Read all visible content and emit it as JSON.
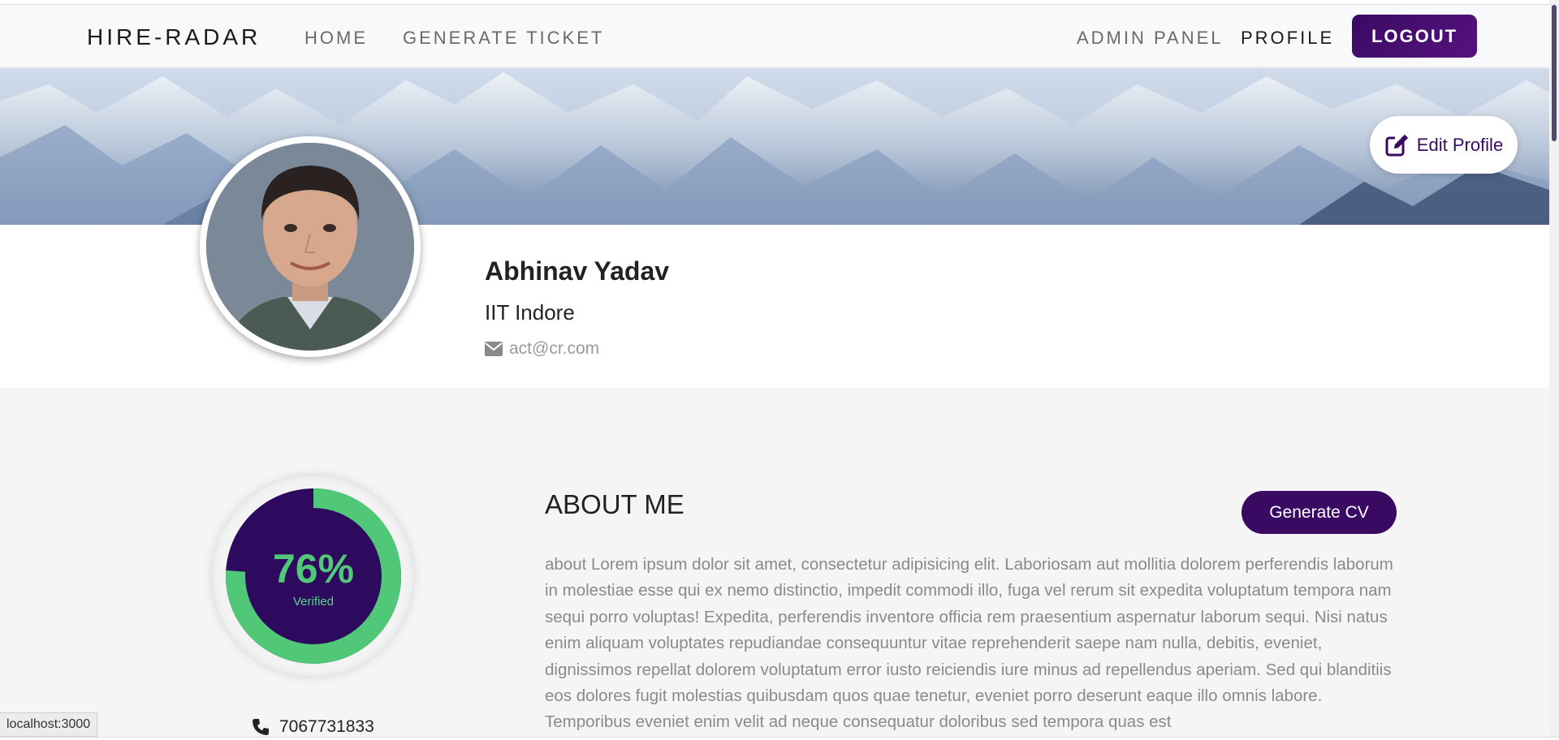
{
  "navbar": {
    "brand": "HIRE-RADAR",
    "links": [
      "HOME",
      "GENERATE TICKET"
    ],
    "admin_label": "ADMIN PANEL",
    "profile_label": "PROFILE",
    "logout_label": "LOGOUT"
  },
  "banner": {
    "edit_profile_label": "Edit Profile"
  },
  "profile": {
    "name": "Abhinav Yadav",
    "institute": "IIT Indore",
    "email": "act@cr.com",
    "phone": "7067731833"
  },
  "verification": {
    "percent_text": "76%",
    "percent_value": 76,
    "label": "Verified"
  },
  "about": {
    "title": "ABOUT ME",
    "generate_cv_label": "Generate CV",
    "body": "about Lorem ipsum dolor sit amet, consectetur adipisicing elit. Laboriosam aut mollitia dolorem perferendis laborum in molestiae esse qui ex nemo distinctio, impedit commodi illo, fuga vel rerum sit expedita voluptatum tempora nam sequi porro voluptas! Expedita, perferendis inventore officia rem praesentium aspernatur laborum sequi. Nisi natus enim aliquam voluptates repudiandae consequuntur vitae reprehenderit saepe nam nulla, debitis, eveniet, dignissimos repellat dolorem voluptatum error iusto reiciendis iure minus ad repellendus aperiam. Sed qui blanditiis eos dolores fugit molestias quibusdam quos quae tenetur, eveniet porro deserunt eaque illo omnis labore. Temporibus eveniet enim velit ad neque consequatur doloribus sed tempora quas est"
  },
  "status_bar": {
    "url": "localhost:3000"
  },
  "colors": {
    "primary": "#3a0a63",
    "ring_green": "#50c878",
    "ring_dark": "#2e0a5f",
    "muted_text": "#8a8a8a"
  },
  "icons": {
    "edit": "edit-icon",
    "email": "envelope-icon",
    "phone": "phone-icon"
  }
}
